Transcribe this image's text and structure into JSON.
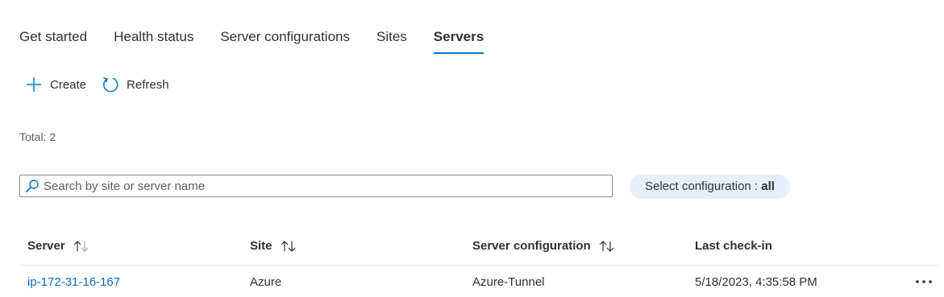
{
  "tabs": [
    {
      "label": "Get started",
      "active": false
    },
    {
      "label": "Health status",
      "active": false
    },
    {
      "label": "Server configurations",
      "active": false
    },
    {
      "label": "Sites",
      "active": false
    },
    {
      "label": "Servers",
      "active": true
    }
  ],
  "toolbar": {
    "create_label": "Create",
    "create_icon": "plus-icon",
    "refresh_label": "Refresh",
    "refresh_icon": "refresh-icon"
  },
  "total_label": "Total: 2",
  "search": {
    "placeholder": "Search by site or server name",
    "value": "",
    "icon": "search-icon"
  },
  "filter": {
    "label": "Select configuration : ",
    "value": "all"
  },
  "table": {
    "columns": [
      {
        "label": "Server",
        "sortable": true
      },
      {
        "label": "Site",
        "sortable": true
      },
      {
        "label": "Server configuration",
        "sortable": true
      },
      {
        "label": "Last check-in",
        "sortable": false
      }
    ],
    "rows": [
      {
        "server": "ip-172-31-16-167",
        "site": "Azure",
        "server_configuration": "Azure-Tunnel",
        "last_check_in": "5/18/2023, 4:35:58 PM"
      }
    ]
  },
  "colors": {
    "accent": "#0078d4",
    "link": "#0f6cbd",
    "pill_bg": "#e5f0fb",
    "text": "#323130"
  }
}
